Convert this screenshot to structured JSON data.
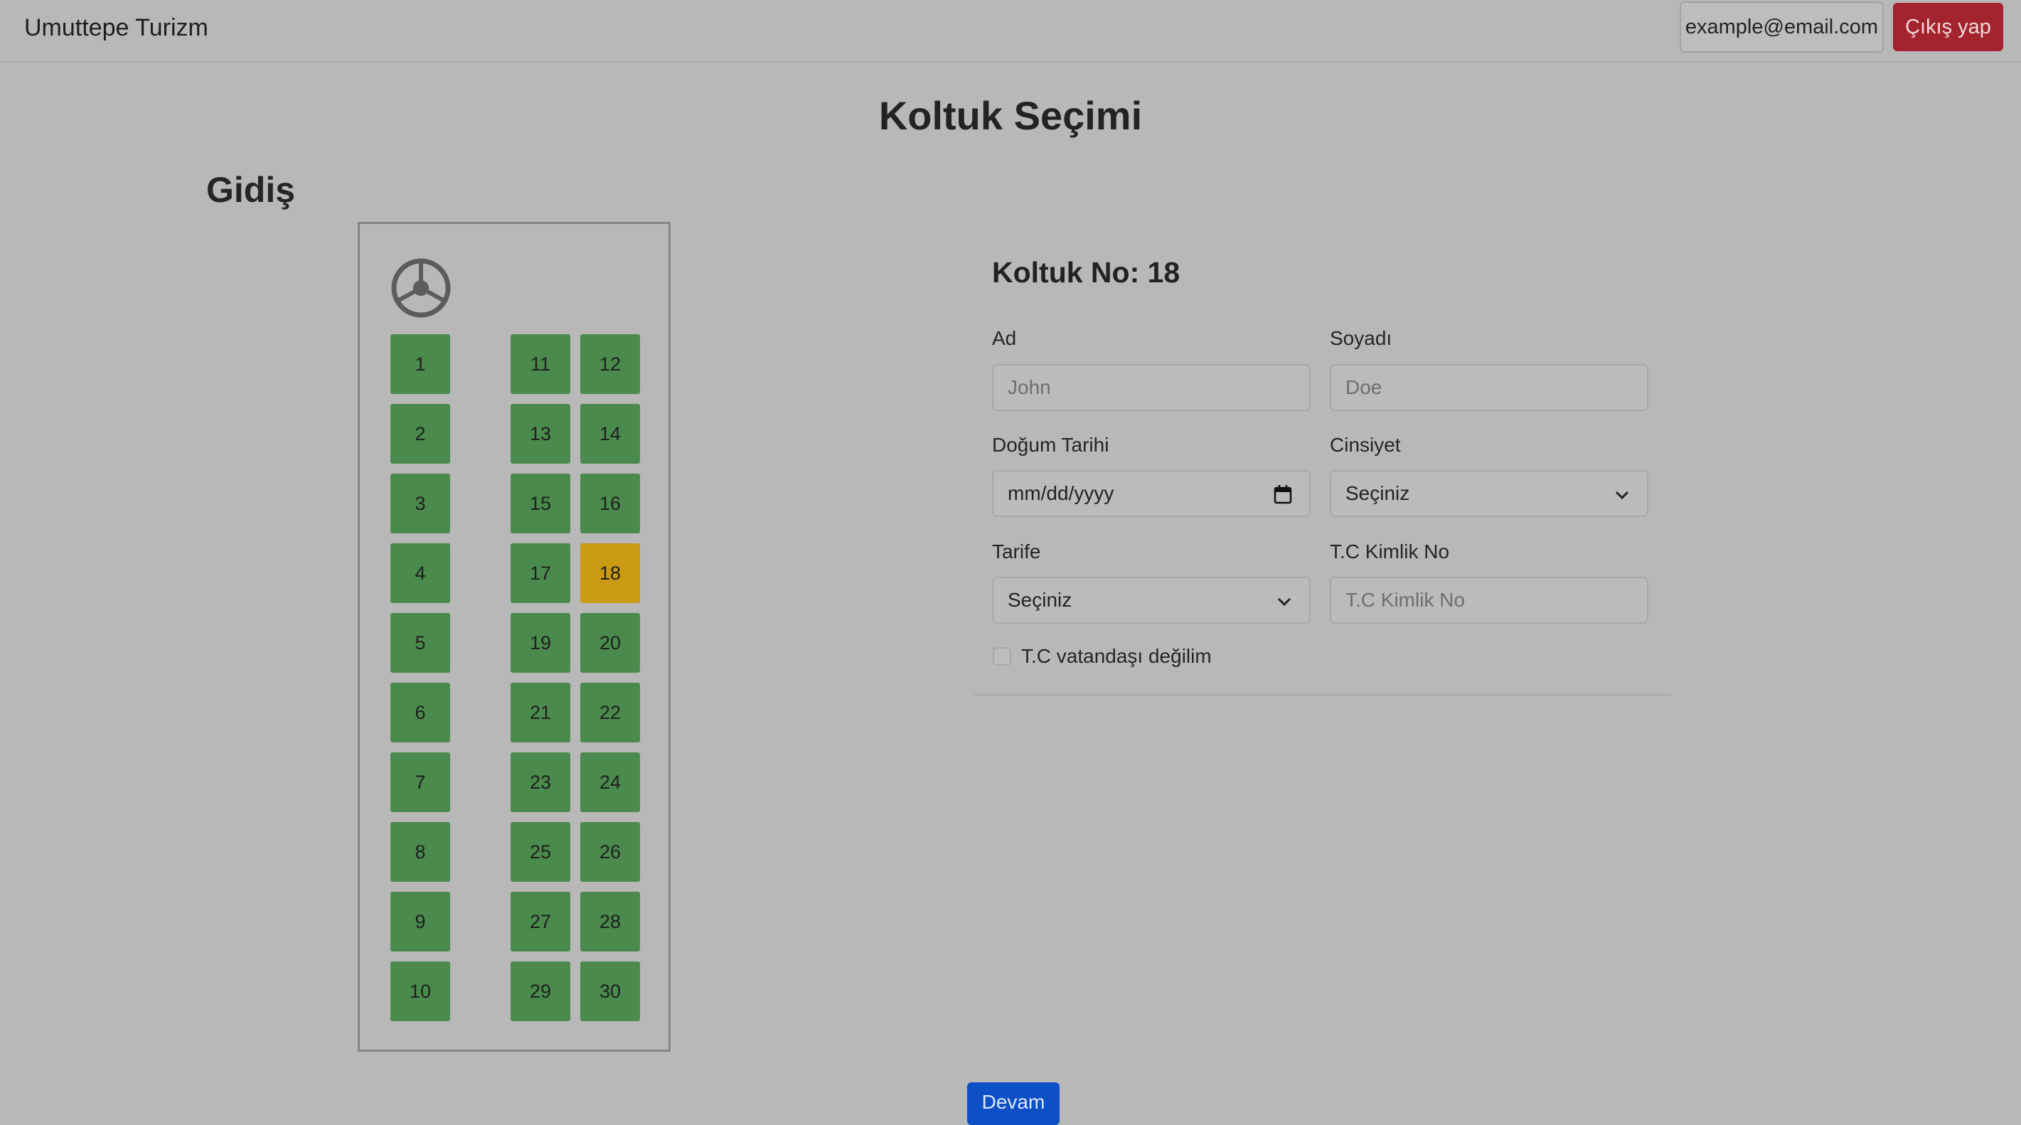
{
  "navbar": {
    "brand": "Umuttepe Turizm",
    "email": "example@email.com",
    "logout_label": "Çıkış yap"
  },
  "page_title": "Koltuk Seçimi",
  "section_title": "Gidiş",
  "seats": {
    "left_column": [
      "1",
      "2",
      "3",
      "4",
      "5",
      "6",
      "7",
      "8",
      "9",
      "10"
    ],
    "right_inner": [
      "11",
      "13",
      "15",
      "17",
      "19",
      "21",
      "23",
      "25",
      "27",
      "29"
    ],
    "right_outer": [
      "12",
      "14",
      "16",
      "18",
      "20",
      "22",
      "24",
      "26",
      "28",
      "30"
    ],
    "selected": "18",
    "colors": {
      "available": "#4a8a4c",
      "selected": "#c99a12"
    }
  },
  "form": {
    "heading": "Koltuk No: 18",
    "first_name": {
      "label": "Ad",
      "placeholder": "John"
    },
    "last_name": {
      "label": "Soyadı",
      "placeholder": "Doe"
    },
    "birth_date": {
      "label": "Doğum Tarihi",
      "value": "mm/dd/yyyy"
    },
    "gender": {
      "label": "Cinsiyet",
      "value": "Seçiniz"
    },
    "tariff": {
      "label": "Tarife",
      "value": "Seçiniz"
    },
    "tc_no": {
      "label": "T.C Kimlik No",
      "placeholder": "T.C Kimlik No"
    },
    "not_citizen_label": "T.C vatandaşı değilim"
  },
  "continue_label": "Devam"
}
